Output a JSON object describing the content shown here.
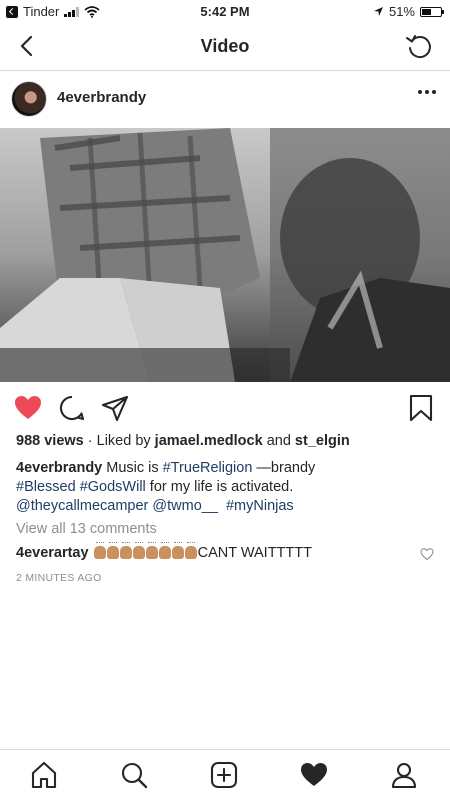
{
  "status_bar": {
    "carrier": "Tinder",
    "time": "5:42 PM",
    "battery_percent": "51%",
    "battery_level": 0.51
  },
  "header": {
    "title": "Video"
  },
  "post": {
    "username": "4everbrandy",
    "stats": {
      "views": "988 views",
      "separator": " · ",
      "liked_by_prefix": "Liked by ",
      "liker1": "jamael.medlock",
      "and_text": " and ",
      "liker2": "st_elgin"
    },
    "caption": {
      "username": "4everbrandy",
      "text1": " Music is ",
      "tag1": "#TrueReligion",
      "text2": " —brandy",
      "tag2": "#Blessed",
      "space1": " ",
      "tag3": "#GodsWill",
      "text3": " for my life is activated.",
      "mention1": "@theycallmecamper",
      "space2": " ",
      "mention2": "@twmo__",
      "space3": "  ",
      "tag4": "#myNinjas"
    },
    "view_all_comments": "View all 13 comments",
    "comment": {
      "username": "4everartay",
      "emoji_count": 8,
      "text": "CANT WAITTTTT"
    },
    "timestamp": "2 MINUTES AGO"
  },
  "icons": {
    "back": "chevron-left-icon",
    "refresh": "refresh-icon",
    "more": "more-options-icon",
    "like": "heart-filled-icon",
    "comment": "comment-icon",
    "share": "paper-plane-icon",
    "save": "bookmark-icon",
    "home": "home-icon",
    "search": "search-icon",
    "new_post": "add-post-icon",
    "activity": "heart-filled-icon",
    "profile": "profile-icon"
  },
  "colors": {
    "like": "#ed4956",
    "hashtag": "#1f3e66",
    "muted": "#8e8e8e"
  }
}
